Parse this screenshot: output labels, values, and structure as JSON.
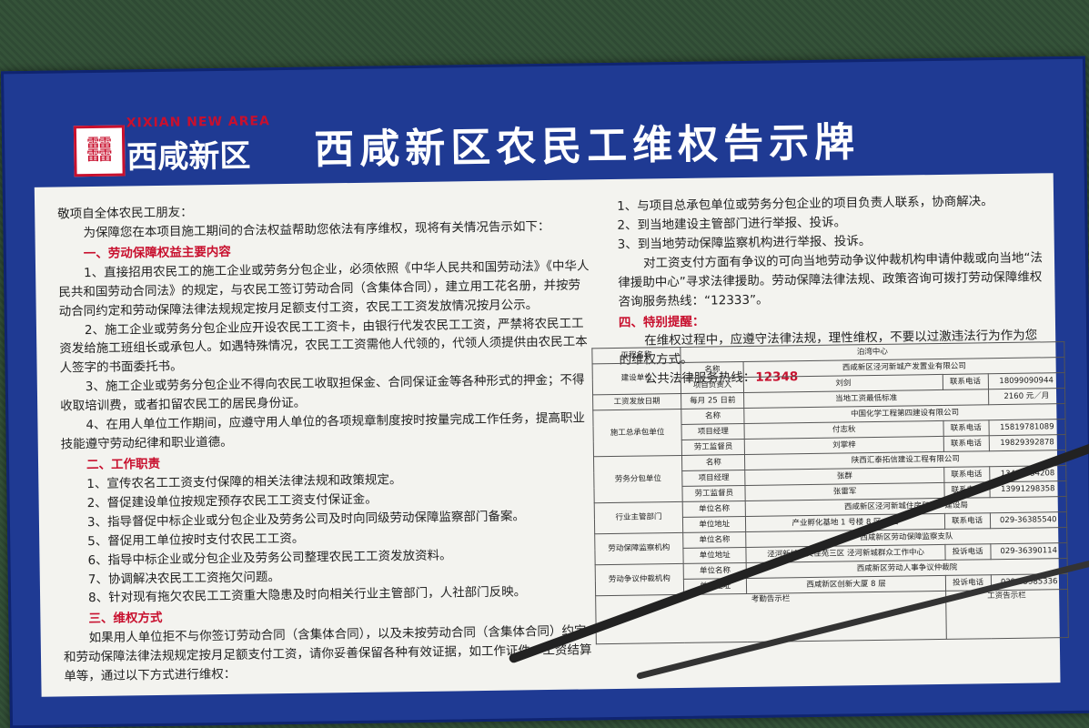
{
  "header": {
    "logo_glyph": "䨻",
    "logo_en": "XIXIAN NEW AREA",
    "logo_zh": "西咸新区",
    "title": "西咸新区农民工维权告示牌"
  },
  "left": {
    "greeting": "敬项自全体农民工朋友：",
    "intro": "为保障您在本项目施工期间的合法权益帮助您依法有序维权，现将有关情况告示如下：",
    "sec1": "一、劳动保障权益主要内容",
    "p1": "1、直接招用农民工的施工企业或劳务分包企业，必须依照《中华人民共和国劳动法》《中华人民共和国劳动合同法》的规定，与农民工签订劳动合同（含集体合同），建立用工花名册，并按劳动合同约定和劳动保障法律法规规定按月足额支付工资，农民工工资发放情况按月公示。",
    "p2": "2、施工企业或劳务分包企业应开设农民工工资卡，由银行代发农民工工资，严禁将农民工工资发给施工班组长或承包人。如遇特殊情况，农民工工资需他人代领的，代领人须提供由农民工本人签字的书面委托书。",
    "p3": "3、施工企业或劳务分包企业不得向农民工收取担保金、合同保证金等各种形式的押金；不得收取培训费，或者扣留农民工的居民身份证。",
    "p4": "4、在用人单位工作期间，应遵守用人单位的各项规章制度按时按量完成工作任务，提高职业技能遵守劳动纪律和职业道德。",
    "sec2": "二、工作职责",
    "d1": "1、宣传农名工工资支付保障的相关法律法规和政策规定。",
    "d2": "2、督促建设单位按规定预存农民工工资支付保证金。",
    "d3": "3、指导督促中标企业或分包企业及劳务公司及时向同级劳动保障监察部门备案。",
    "d4": "5、督促用工单位按时支付农民工工资。",
    "d5": "6、指导中标企业或分包企业及劳务公司整理农民工工资发放资料。",
    "d6": "7、协调解决农民工工资拖欠问题。",
    "d7": "8、针对现有拖欠农民工工资重大隐患及时向相关行业主管部门，人社部门反映。",
    "sec3": "三、维权方式",
    "p5": "如果用人单位拒不与你签订劳动合同（含集体合同），以及未按劳动合同（含集体合同）约定和劳动保障法律法规规定按月足额支付工资，请你妥善保留各种有效证据，如工作证件、工资结算单等，通过以下方式进行维权："
  },
  "right": {
    "r1": "1、与项目总承包单位或劳务分包企业的项目负责人联系，协商解决。",
    "r2": "2、到当地建设主管部门进行举报、投诉。",
    "r3": "3、到当地劳动保障监察机构进行举报、投诉。",
    "r4": "对工资支付方面有争议的可向当地劳动争议仲裁机构申请仲裁或向当地“法律援助中心”寻求法律援助。劳动保障法律法规、政策咨询可拨打劳动保障维权咨询服务热线：“12333”。",
    "sec4": "四、特别提醒：",
    "r5": "在维权过程中，应遵守法律法规，理性维权，不要以过激违法行为作为您的维权方式。",
    "hotline_label": "公共法律服务热线：",
    "hotline": "12348"
  },
  "table": {
    "project_label": "工程名称",
    "project": "泊湾中心",
    "build_label": "建设单位",
    "name_label": "名称",
    "build_name": "西咸新区泾河新城产发置业有限公司",
    "leader_label": "项目负责人",
    "leader": "刘剑",
    "contact_label": "联系电话",
    "build_phone": "18099090944",
    "pay_label": "工资发放日期",
    "pay_date": "每月 25 日前",
    "min_wage_label": "当地工资最低标准",
    "min_wage": "2160 元／月",
    "gc_label": "施工总承包单位",
    "gc_name": "中国化学工程第四建设有限公司",
    "pm_label": "项目经理",
    "gc_pm": "付志秋",
    "gc_phone": "15819781089",
    "sup_label": "劳工监督员",
    "gc_sup": "刘掌梓",
    "gc_sup_phone": "19829392878",
    "sub_label": "劳务分包单位",
    "sub_name": "陕西汇泰拓信建设工程有限公司",
    "sub_pm": "张群",
    "sub_phone": "13488334208",
    "sub_sup": "张雷军",
    "sub_sup_phone": "13991298358",
    "ind_label": "行业主管部门",
    "unit_name_label": "单位名称",
    "ind_name": "西咸新区泾河新城住房和城乡建设局",
    "addr_label": "单位地址",
    "ind_addr": "产业孵化基地 1 号楼 8 区 2 层",
    "ind_phone": "029-36385540",
    "mon_label": "劳动保障监察机构",
    "mon_name": "西咸新区劳动保障监察支队",
    "mon_addr": "泾河新城崇文佳苑三区 泾河新城群众工作中心",
    "complaint_label": "投诉电话",
    "mon_phone": "029-36390114",
    "arb_label": "劳动争议仲裁机构",
    "arb_name": "西咸新区劳动人事争议仲裁院",
    "arb_addr": "西咸新区创新大厦 8 层",
    "arb_phone": "029-33585336",
    "comp_board_label": "考勤告示栏",
    "wage_board_label": "工资告示栏"
  },
  "colors": {
    "board": "#1f3a93",
    "panel": "#f3f3ef",
    "accent": "#c8102e"
  }
}
